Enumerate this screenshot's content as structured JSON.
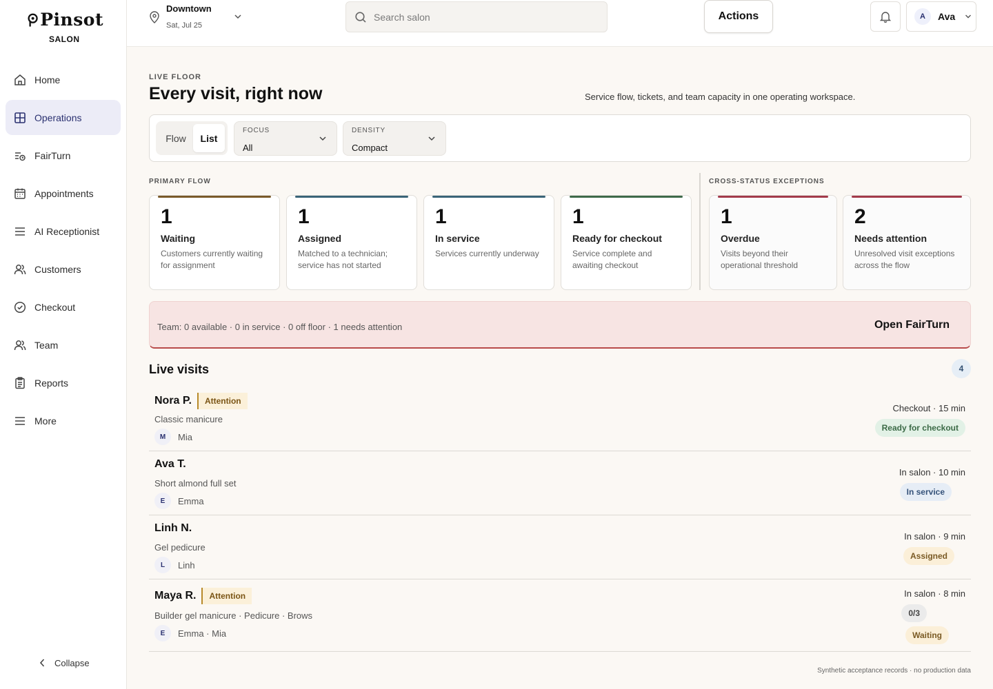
{
  "brand": {
    "name": "Pinsot",
    "sub": "SALON"
  },
  "sidebar": {
    "items": [
      {
        "label": "Home",
        "icon": "home-icon"
      },
      {
        "label": "Operations",
        "icon": "grid-icon",
        "active": true
      },
      {
        "label": "FairTurn",
        "icon": "rotation-icon"
      },
      {
        "label": "Appointments",
        "icon": "calendar-icon"
      },
      {
        "label": "AI Receptionist",
        "icon": "menu-lines-icon"
      },
      {
        "label": "Customers",
        "icon": "users-icon"
      },
      {
        "label": "Checkout",
        "icon": "check-circle-icon"
      },
      {
        "label": "Team",
        "icon": "users-icon"
      },
      {
        "label": "Reports",
        "icon": "clipboard-icon"
      },
      {
        "label": "More",
        "icon": "menu-lines-icon"
      }
    ],
    "collapse_label": "Collapse"
  },
  "topbar": {
    "location": "Downtown",
    "date": "Sat, Jul 25",
    "search_placeholder": "Search salon",
    "actions_label": "Actions",
    "user_initial": "A",
    "user_name": "Ava"
  },
  "page": {
    "eyebrow": "LIVE FLOOR",
    "title": "Every visit, right now",
    "subtitle": "Service flow, tickets, and team capacity in one operating workspace."
  },
  "controls": {
    "view_options": [
      "Flow",
      "List"
    ],
    "active_view": "List",
    "focus_label": "FOCUS",
    "focus_value": "All",
    "density_label": "DENSITY",
    "density_value": "Compact"
  },
  "primary_flow": {
    "label": "PRIMARY FLOW",
    "cards": [
      {
        "count": "1",
        "label": "Waiting",
        "desc": "Customers currently waiting for assignment",
        "color": "#7a5a2a"
      },
      {
        "count": "1",
        "label": "Assigned",
        "desc": "Matched to a technician; service has not started",
        "color": "#3a6478"
      },
      {
        "count": "1",
        "label": "In service",
        "desc": "Services currently underway",
        "color": "#3a6478"
      },
      {
        "count": "1",
        "label": "Ready for checkout",
        "desc": "Service complete and awaiting checkout",
        "color": "#3e6a4a"
      }
    ]
  },
  "exceptions": {
    "label": "CROSS-STATUS EXCEPTIONS",
    "cards": [
      {
        "count": "1",
        "label": "Overdue",
        "desc": "Visits beyond their operational threshold",
        "color": "#a33a4a"
      },
      {
        "count": "2",
        "label": "Needs attention",
        "desc": "Unresolved visit exceptions across the flow",
        "color": "#a33a4a"
      }
    ]
  },
  "team_banner": {
    "text": "Team: 0 available · 0 in service · 0 off floor · 1 needs attention",
    "link_label": "Open FairTurn"
  },
  "live_visits": {
    "title": "Live visits",
    "count": "4",
    "visits": [
      {
        "name": "Nora P.",
        "attention": "Attention",
        "service": "Classic manicure",
        "tech_initial": "M",
        "techs": "Mia",
        "meta": "Checkout · 15 min",
        "pills": [
          {
            "text": "Ready for checkout",
            "tone": "green"
          }
        ]
      },
      {
        "name": "Ava T.",
        "attention": "",
        "service": "Short almond full set",
        "tech_initial": "E",
        "techs": "Emma",
        "meta": "In salon · 10 min",
        "pills": [
          {
            "text": "In service",
            "tone": "blue"
          }
        ]
      },
      {
        "name": "Linh N.",
        "attention": "",
        "service": "Gel pedicure",
        "tech_initial": "L",
        "techs": "Linh",
        "meta": "In salon · 9 min",
        "pills": [
          {
            "text": "Assigned",
            "tone": "amber"
          }
        ]
      },
      {
        "name": "Maya R.",
        "attention": "Attention",
        "service": "Builder gel manicure · Pedicure · Brows",
        "tech_initial": "E",
        "techs": "Emma · Mia",
        "meta": "In salon · 8 min",
        "pills": [
          {
            "text": "0/3",
            "tone": "gray"
          },
          {
            "text": "Waiting",
            "tone": "amber"
          }
        ]
      }
    ]
  },
  "footer_note": "Synthetic acceptance records · no production data"
}
